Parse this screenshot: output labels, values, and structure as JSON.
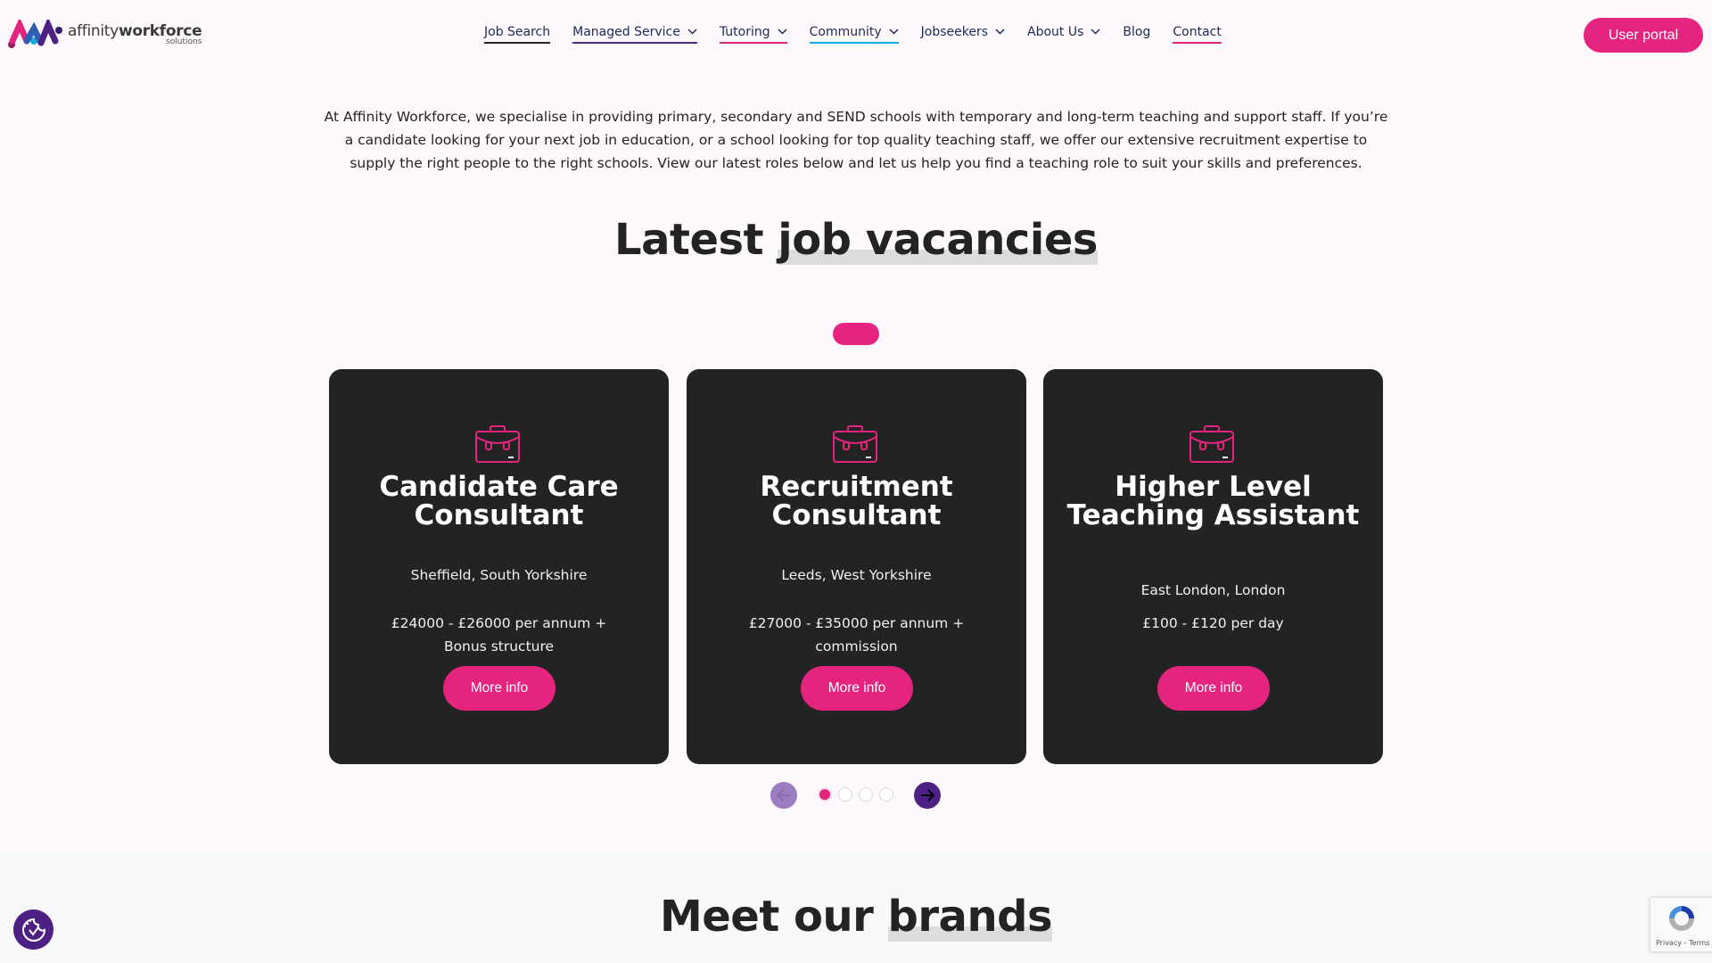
{
  "header": {
    "logo": {
      "main_light": "affinity",
      "main_bold": "workforce",
      "sub": "solutions"
    },
    "nav": [
      {
        "label": "Job Search",
        "dropdown": false,
        "underline": "#232323"
      },
      {
        "label": "Managed Service",
        "dropdown": true,
        "underline": "#4d2a86"
      },
      {
        "label": "Tutoring",
        "dropdown": true,
        "underline": "#e5247f"
      },
      {
        "label": "Community",
        "dropdown": true,
        "underline": "#19a9de"
      },
      {
        "label": "Jobseekers",
        "dropdown": true,
        "underline": ""
      },
      {
        "label": "About Us",
        "dropdown": true,
        "underline": ""
      },
      {
        "label": "Blog",
        "dropdown": false,
        "underline": ""
      },
      {
        "label": "Contact",
        "dropdown": false,
        "underline": "#e5247f"
      }
    ],
    "user_portal_label": "User portal"
  },
  "intro": {
    "text": "At Affinity Workforce, we specialise in providing primary, secondary and SEND schools with temporary and long-term teaching and support staff. If you’re a candidate looking for your next job in education, or a school looking for top quality teaching staff, we offer our extensive recruitment expertise to supply the right people to the right schools. View our latest roles below and let us help you find a teaching role to suit your skills and preferences."
  },
  "jobs_section": {
    "title_plain": "Latest ",
    "title_highlight": "job vacancies",
    "cards": [
      {
        "icon": "briefcase-icon",
        "title": "Candidate Care Consultant",
        "location": "Sheffield, South Yorkshire",
        "salary": "£24000 - £26000 per annum + Bonus structure",
        "button": "More info"
      },
      {
        "icon": "briefcase-icon",
        "title": "Recruitment Consultant",
        "location": "Leeds, West Yorkshire",
        "salary": "£27000 - £35000 per annum + commission",
        "button": "More info"
      },
      {
        "icon": "briefcase-icon",
        "title": "Higher Level Teaching Assistant",
        "location": "East London, London",
        "salary": "£100 - £120 per day",
        "button": "More info"
      }
    ],
    "carousel": {
      "pages": 4,
      "current_page": 1
    }
  },
  "brands_section": {
    "title_plain": "Meet our ",
    "title_highlight": "brands"
  },
  "recaptcha": {
    "terms": "Privacy - Terms"
  },
  "colors": {
    "accent_pink": "#e5247f",
    "accent_purple": "#4d2183",
    "card_bg": "#232323",
    "page_bg": "#fdf8fc"
  }
}
